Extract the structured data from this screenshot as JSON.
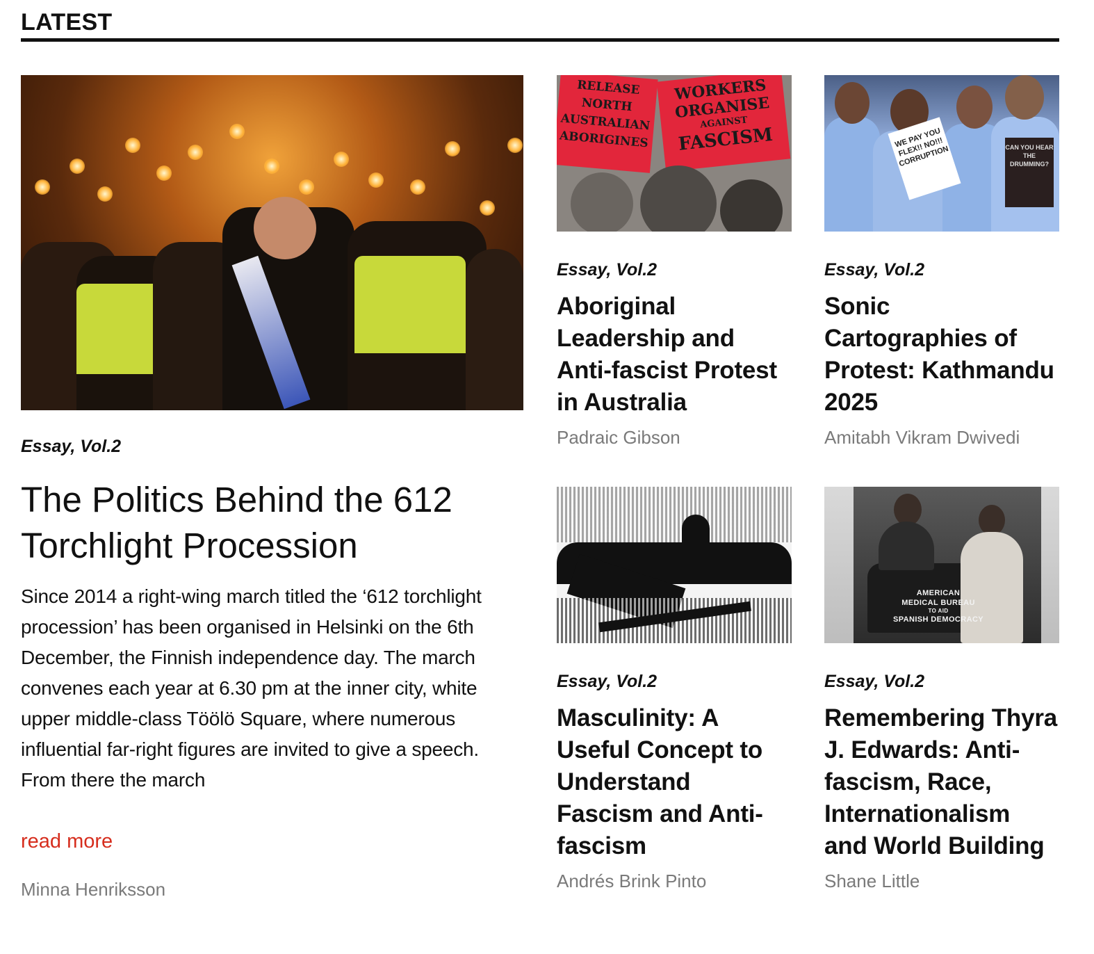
{
  "section": {
    "title": "LATEST"
  },
  "featured": {
    "category": "Essay, Vol.2",
    "title": "The Politics Behind the 612 Torchlight Procession",
    "excerpt": "Since 2014 a right-wing march titled the ‘612 torchlight procession’ has been organised in Helsinki on the 6th December, the Finnish independence day. The march convenes each year at 6.30 pm at the inner city, white upper middle-class Töölö Square, where numerous influential far-right figures are invited to give a speech. From there the march",
    "read_more": "read more",
    "author": "Minna Henriksson",
    "image_alt": "torchlight-procession-photo"
  },
  "cards": [
    {
      "category": "Essay, Vol.2",
      "title": "Aboriginal Leadership and Anti-fascist Protest in Australia",
      "author": "Padraic Gibson",
      "image_alt": "protest-poster-artwork",
      "image_text": {
        "sign_left": "RELEASE NORTH AUSTRALIAN ABORIGINES",
        "sign_right_1": "WORKERS ORGANISE",
        "sign_right_2": "AGAINST",
        "sign_right_3": "FASCISM"
      }
    },
    {
      "category": "Essay, Vol.2",
      "title": "Sonic Cartographies of Protest: Kathmandu 2025",
      "author": "Amitabh Vikram Dwivedi",
      "image_alt": "student-protest-photo",
      "image_text": {
        "placard_1": "WE PAY YOU FLEX!! NO!!! CORRUPTION",
        "placard_2": "CAN YOU HEAR THE DRUMMING?"
      }
    },
    {
      "category": "Essay, Vol.2",
      "title": "Masculinity: A Useful Concept to Understand Fascism and Anti-fascism",
      "author": "Andrés Brink Pinto",
      "image_alt": "halftone-crowd-illustration"
    },
    {
      "category": "Essay, Vol.2",
      "title": "Remembering Thyra J. Edwards: Anti-fascism, Race, Internationalism and World Building",
      "author": "Shane Little",
      "image_alt": "archival-photo-ambulance",
      "image_text": {
        "car_text_1": "AMERICAN",
        "car_text_2": "MEDICAL BUREAU",
        "car_text_3": "TO AID",
        "car_text_4": "SPANISH DEMOCRACY"
      }
    }
  ],
  "colors": {
    "accent": "#d62d1d",
    "muted": "#7a7a7a",
    "text": "#111111"
  }
}
